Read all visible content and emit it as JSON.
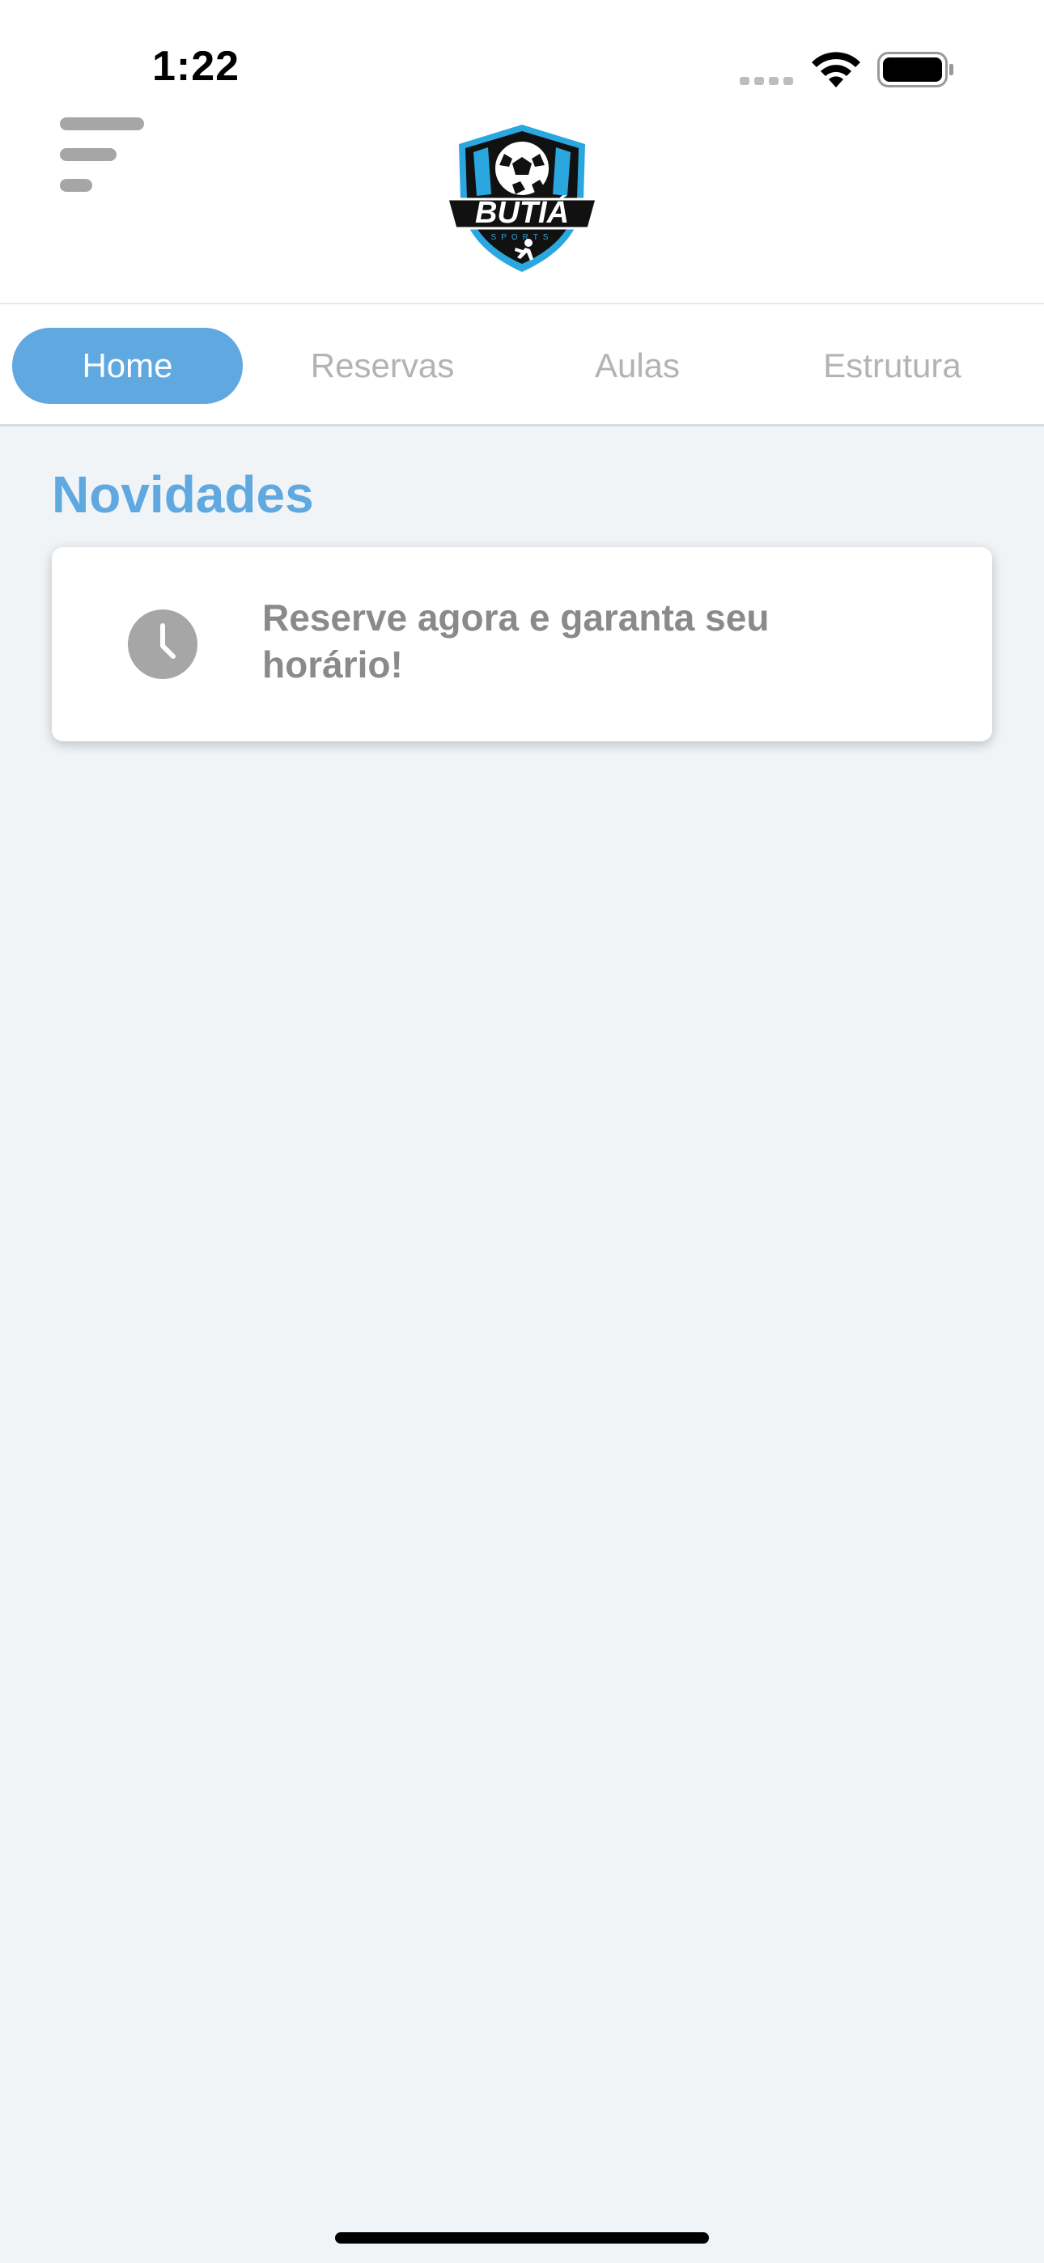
{
  "status_bar": {
    "time": "1:22"
  },
  "header": {
    "menu_icon": "menu-lines-icon",
    "logo": {
      "brand_text": "BUTIÁ",
      "sub_text": "SPORTS"
    }
  },
  "tabs": [
    {
      "label": "Home",
      "active": true
    },
    {
      "label": "Reservas",
      "active": false
    },
    {
      "label": "Aulas",
      "active": false
    },
    {
      "label": "Estrutura",
      "active": false
    }
  ],
  "main": {
    "section_title": "Novidades",
    "news": [
      {
        "icon": "clock-icon",
        "text": "Reserve agora e garanta seu horário!"
      }
    ]
  },
  "colors": {
    "accent": "#5fa8e0",
    "background": "#f0f4f7",
    "inactive_tab": "#b3b3b3",
    "card_text": "#8a8a8a",
    "icon_gray": "#a6a6a6"
  }
}
